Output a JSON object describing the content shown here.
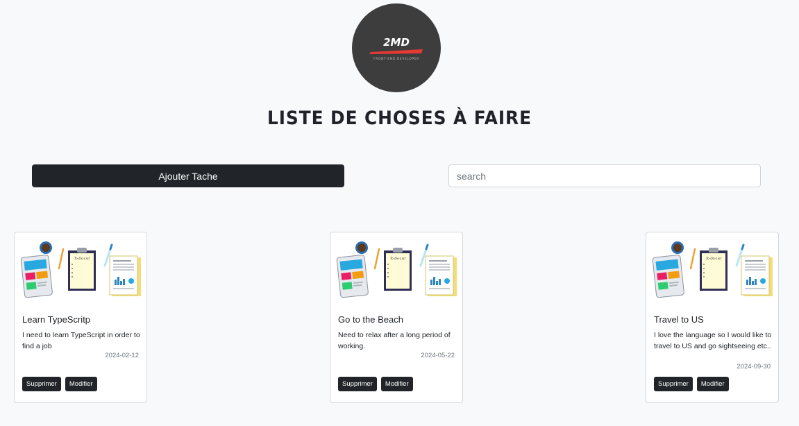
{
  "logo": {
    "brand": "2MD",
    "tagline": "FRONT-END DEVELOPER"
  },
  "page_title": "LISTE DE CHOSES À FAIRE",
  "toolbar": {
    "add_label": "Ajouter Tache",
    "search_placeholder": "search",
    "search_value": ""
  },
  "illustration_text": "To-Do-List",
  "tasks": [
    {
      "title": "Learn TypeScritp",
      "description": "I need to learn TypeScript in order to find a job",
      "date": "2024-02-12",
      "delete_label": "Supprimer",
      "edit_label": "Modifier"
    },
    {
      "title": "Go to the Beach",
      "description": "Need to relax after a long period of working.",
      "date": "2024-05-22",
      "delete_label": "Supprimer",
      "edit_label": "Modifier"
    },
    {
      "title": "Travel to US",
      "description": "I love the language so I would like to travel to US and go sightseeing etc..",
      "date": "2024-09-30",
      "delete_label": "Supprimer",
      "edit_label": "Modifier"
    }
  ],
  "colors": {
    "page_bg": "#f8f9fb",
    "dark": "#212529",
    "logo_bg": "#3d3d3d",
    "logo_accent": "#e53935"
  }
}
